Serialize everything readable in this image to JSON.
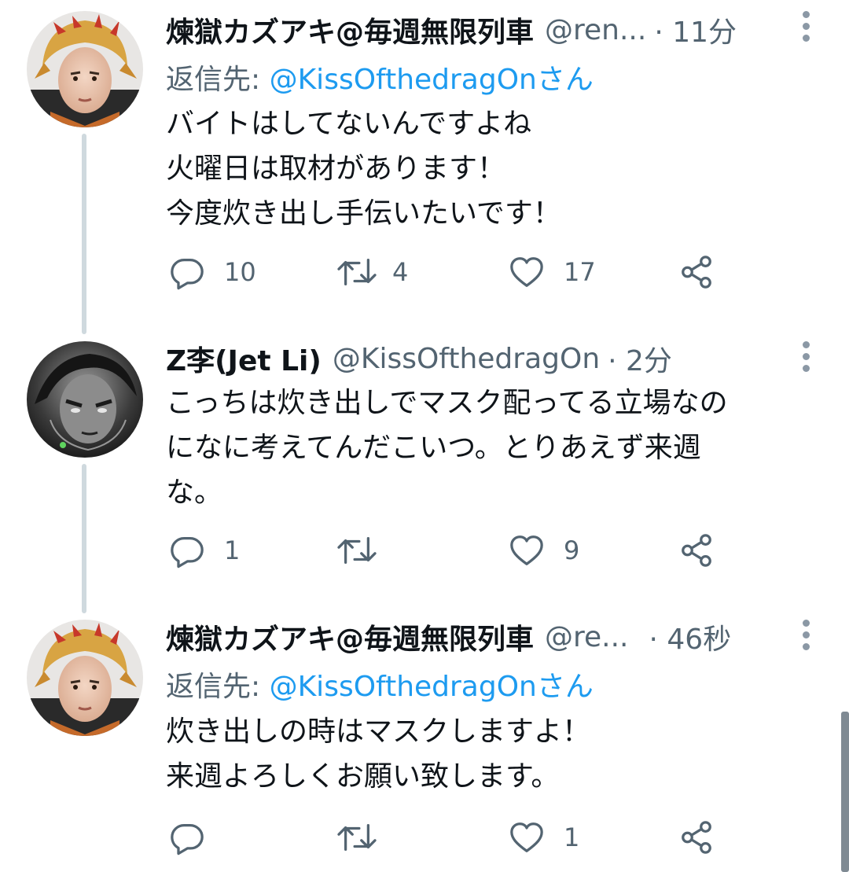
{
  "tweets": [
    {
      "name": "煉獄カズアキ@毎週無限列車",
      "handle": "@ren...",
      "time": "· 11分",
      "reply_prefix": "返信先: ",
      "reply_mention": "@KissOfthedragOnさん",
      "lines": [
        "バイトはしてないんですよね",
        "火曜日は取材があります！",
        "今度炊き出し手伝いたいです！"
      ],
      "replies": "10",
      "retweets": "4",
      "likes": "17"
    },
    {
      "name": "Z李(Jet Li)",
      "handle": "@KissOfthedragOn",
      "time": "· 2分",
      "lines": [
        "こっちは炊き出しでマスク配ってる立場なの",
        "になに考えてんだこいつ。とりあえず来週",
        "な。"
      ],
      "replies": "1",
      "retweets": "",
      "likes": "9"
    },
    {
      "name": "煉獄カズアキ@毎週無限列車",
      "handle": "@re...",
      "time": "· 46秒",
      "reply_prefix": "返信先: ",
      "reply_mention": "@KissOfthedragOnさん",
      "lines": [
        "炊き出しの時はマスクしますよ！",
        "来週よろしくお願い致します。"
      ],
      "replies": "",
      "retweets": "",
      "likes": "1"
    }
  ],
  "icons": {
    "reply": "reply-icon",
    "retweet": "retweet-icon",
    "like": "heart-icon",
    "share": "share-icon",
    "more": "more-vertical-icon"
  },
  "colors": {
    "text": "#0f1419",
    "secondary": "#536471",
    "link": "#1d9bf0",
    "thread_line": "#cfd9de"
  }
}
